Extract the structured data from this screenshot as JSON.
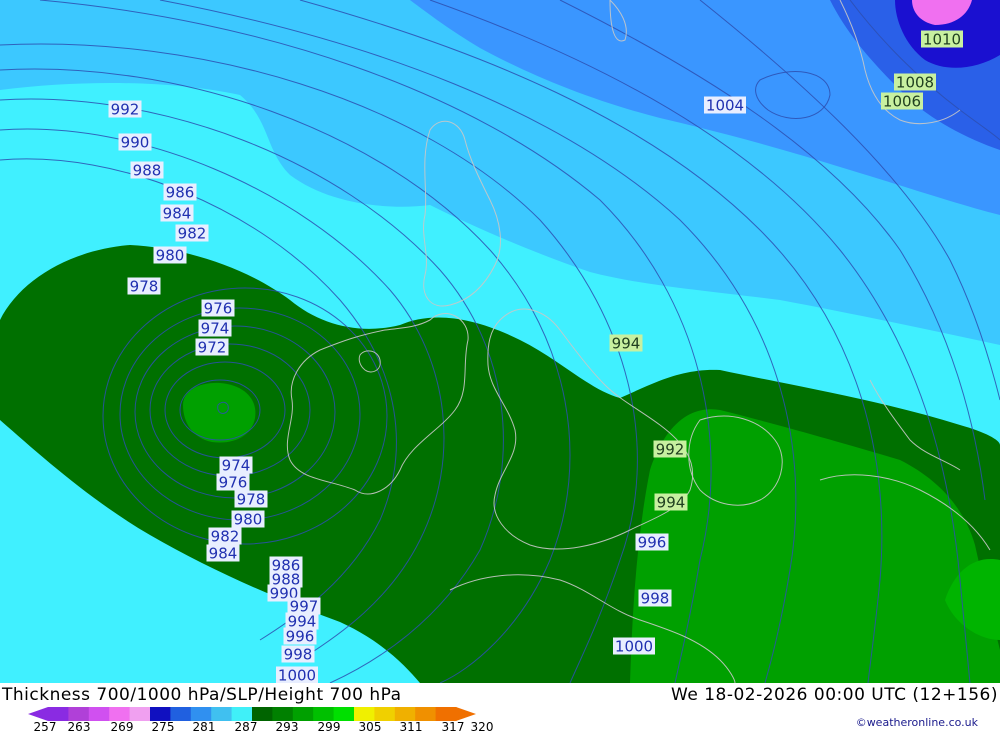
{
  "title": "Thickness 700/1000 hPa/SLP/Height 700 hPa",
  "valid_time": "We 18-02-2026 00:00 UTC (12+156)",
  "credit": "©weatheronline.co.uk",
  "legend": {
    "ticks": [
      "257",
      "263",
      "269",
      "275",
      "281",
      "287",
      "293",
      "299",
      "305",
      "311",
      "317",
      "320"
    ],
    "colors": [
      "#8a2be2",
      "#b040d8",
      "#d050f0",
      "#f070f0",
      "#f0a0f0",
      "#1010c0",
      "#2060e0",
      "#3090f0",
      "#40c0f0",
      "#40f0f8",
      "#006400",
      "#008000",
      "#00a000",
      "#00c000",
      "#00e000",
      "#f0f000",
      "#f0d000",
      "#f0b000",
      "#f09000",
      "#f07000"
    ]
  },
  "zones": {
    "cyan": "#40f0ff",
    "light_blue": "#3cc8ff",
    "mid_blue": "#3a96ff",
    "dark_blue": "#2a60e8",
    "deep_blue": "#1a10d0",
    "pink": "#f070f0",
    "dark_green": "#007000",
    "mid_green": "#00a000",
    "light_green": "#00b400"
  },
  "pressure_labels": [
    {
      "text": "992",
      "style": "blue"
    },
    {
      "text": "990",
      "style": "blue"
    },
    {
      "text": "988",
      "style": "blue"
    },
    {
      "text": "986",
      "style": "blue"
    },
    {
      "text": "984",
      "style": "blue"
    },
    {
      "text": "982",
      "style": "blue"
    },
    {
      "text": "980",
      "style": "blue"
    },
    {
      "text": "978",
      "style": "blue"
    },
    {
      "text": "976",
      "style": "blue"
    },
    {
      "text": "974",
      "style": "blue"
    },
    {
      "text": "972",
      "style": "blue"
    },
    {
      "text": "974",
      "style": "blue"
    },
    {
      "text": "976",
      "style": "blue"
    },
    {
      "text": "978",
      "style": "blue"
    },
    {
      "text": "980",
      "style": "blue"
    },
    {
      "text": "982",
      "style": "blue"
    },
    {
      "text": "984",
      "style": "blue"
    },
    {
      "text": "986",
      "style": "blue"
    },
    {
      "text": "988",
      "style": "blue"
    },
    {
      "text": "990",
      "style": "blue"
    },
    {
      "text": "997",
      "style": "blue"
    },
    {
      "text": "994",
      "style": "blue"
    },
    {
      "text": "996",
      "style": "blue"
    },
    {
      "text": "998",
      "style": "blue"
    },
    {
      "text": "1000",
      "style": "blue"
    },
    {
      "text": "1004",
      "style": "blue"
    },
    {
      "text": "1010",
      "style": "green"
    },
    {
      "text": "1008",
      "style": "green"
    },
    {
      "text": "1006",
      "style": "green"
    },
    {
      "text": "994",
      "style": "green"
    },
    {
      "text": "992",
      "style": "green"
    },
    {
      "text": "994",
      "style": "green"
    },
    {
      "text": "996",
      "style": "blue"
    },
    {
      "text": "998",
      "style": "blue"
    },
    {
      "text": "1000",
      "style": "blue"
    }
  ]
}
